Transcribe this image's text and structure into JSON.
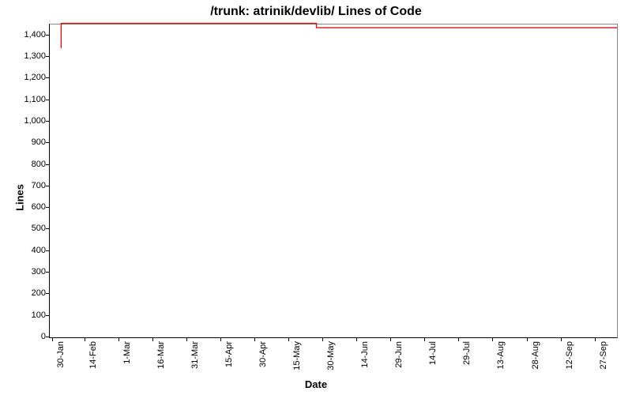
{
  "chart_data": {
    "type": "line",
    "title": "/trunk: atrinik/devlib/ Lines of Code",
    "xlabel": "Date",
    "ylabel": "Lines",
    "ylim": [
      0,
      1450
    ],
    "y_ticks": [
      0,
      100,
      200,
      300,
      400,
      500,
      600,
      700,
      800,
      900,
      1000,
      1100,
      1200,
      1300,
      1400
    ],
    "y_tick_labels": [
      "0",
      "100",
      "200",
      "300",
      "400",
      "500",
      "600",
      "700",
      "800",
      "900",
      "1,000",
      "1,100",
      "1,200",
      "1,300",
      "1,400"
    ],
    "x_tick_positions": [
      0.005,
      0.062,
      0.122,
      0.182,
      0.242,
      0.302,
      0.362,
      0.422,
      0.482,
      0.542,
      0.602,
      0.662,
      0.722,
      0.782,
      0.842,
      0.902,
      0.962
    ],
    "x_tick_labels": [
      "30-Jan",
      "14-Feb",
      "1-Mar",
      "16-Mar",
      "31-Mar",
      "15-Apr",
      "30-Apr",
      "15-May",
      "30-May",
      "14-Jun",
      "29-Jun",
      "14-Jul",
      "29-Jul",
      "13-Aug",
      "28-Aug",
      "12-Sep",
      "27-Sep"
    ],
    "series": [
      {
        "name": "Lines of Code",
        "color": "#d01515",
        "points": [
          {
            "x": 0.02,
            "y": 1340
          },
          {
            "x": 0.02,
            "y": 1455
          },
          {
            "x": 0.47,
            "y": 1455
          },
          {
            "x": 0.47,
            "y": 1435
          },
          {
            "x": 1.0,
            "y": 1435
          }
        ]
      }
    ]
  }
}
